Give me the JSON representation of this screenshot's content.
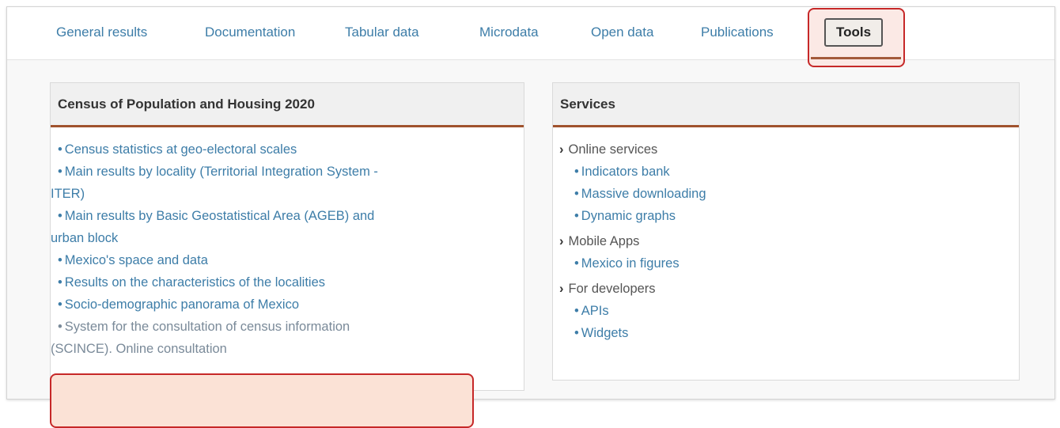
{
  "tabs": [
    {
      "label": "General results"
    },
    {
      "label": "Documentation"
    },
    {
      "label": "Tabular data"
    },
    {
      "label": "Microdata"
    },
    {
      "label": "Open data"
    },
    {
      "label": "Publications"
    },
    {
      "label": "Tools"
    }
  ],
  "left_panel": {
    "title": "Census of Population and Housing 2020",
    "items": [
      [
        "Census statistics at geo-electoral scales"
      ],
      [
        "Main results by locality (Territorial Integration System -",
        "ITER)"
      ],
      [
        "Main results by Basic Geostatistical Area (AGEB) and",
        "urban block"
      ],
      [
        "Mexico's space and data"
      ],
      [
        "Results on the characteristics of the localities"
      ],
      [
        "Socio-demographic panorama of Mexico"
      ],
      [
        "System for the consultation of census information",
        "(SCINCE). Online consultation"
      ]
    ]
  },
  "right_panel": {
    "title": "Services",
    "groups": [
      {
        "label": "Online services",
        "items": [
          "Indicators bank",
          "Massive downloading",
          "Dynamic graphs"
        ]
      },
      {
        "label": "Mobile Apps",
        "items": [
          "Mexico in figures"
        ]
      },
      {
        "label": "For developers",
        "items": [
          "APIs",
          "Widgets"
        ]
      }
    ]
  }
}
